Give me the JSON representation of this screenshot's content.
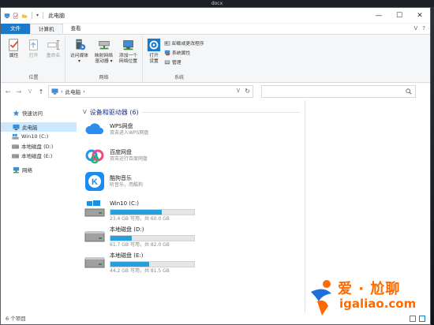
{
  "desktop": {
    "top_text": "docx"
  },
  "window": {
    "title": "此电脑",
    "controls": {
      "minimize": "—",
      "maximize": "☐",
      "close": "✕"
    }
  },
  "ribbon": {
    "tabs": [
      {
        "label": "文件"
      },
      {
        "label": "计算机"
      },
      {
        "label": "查看"
      }
    ],
    "right_controls": {
      "collapse": "ᐯ",
      "help": "?"
    },
    "groups": {
      "location": {
        "label": "位置",
        "buttons": [
          {
            "label": "属性"
          },
          {
            "label": "打开"
          },
          {
            "label": "重命名"
          }
        ]
      },
      "network": {
        "label": "网络",
        "buttons": [
          {
            "label_1": "访问媒体",
            "label_2": "▾"
          },
          {
            "label_1": "映射网络",
            "label_2": "驱动器 ▾"
          },
          {
            "label_1": "添加一个",
            "label_2": "网络位置"
          }
        ]
      },
      "system": {
        "label": "系统",
        "open_settings": {
          "label_1": "打开",
          "label_2": "设置"
        },
        "items": [
          {
            "label": "卸载或更改程序"
          },
          {
            "label": "系统属性"
          },
          {
            "label": "管理"
          }
        ]
      }
    }
  },
  "address": {
    "back": "←",
    "forward": "→",
    "recent": "ᐯ",
    "up": "↑",
    "separator": "›",
    "location": "此电脑",
    "location_sep": "›",
    "dropdown": "ᐯ",
    "refresh": "↻",
    "search_placeholder": ""
  },
  "nav": {
    "quick_access": "快速访问",
    "this_pc": "此电脑",
    "drives": [
      {
        "label": "Win10 (C:)"
      },
      {
        "label": "本地磁盘 (D:)"
      },
      {
        "label": "本地磁盘 (E:)"
      }
    ],
    "network": "网络"
  },
  "content": {
    "group_title": "设备和驱动器 (6)",
    "apps": [
      {
        "name": "WPS网盘",
        "subtitle": "双击进入WPS网盘"
      },
      {
        "name": "百度网盘",
        "subtitle": "双击运行百度网盘"
      },
      {
        "name": "酷狗音乐",
        "subtitle": "听音乐，用酷狗"
      }
    ],
    "drives": [
      {
        "name": "Win10 (C:)",
        "free_text": "23.4 GB 可用，共 60.0 GB",
        "used_fraction": 0.61,
        "windows": true
      },
      {
        "name": "本地磁盘 (D:)",
        "free_text": "61.7 GB 可用，共 82.0 GB",
        "used_fraction": 0.25,
        "windows": false
      },
      {
        "name": "本地磁盘 (E:)",
        "free_text": "44.2 GB 可用，共 81.5 GB",
        "used_fraction": 0.46,
        "windows": false
      }
    ]
  },
  "status": {
    "items_count": "6 个项目"
  },
  "watermark": {
    "line1": "爱 · 尬聊",
    "line2": "igaliao.com"
  },
  "colors": {
    "accent": "#1979ca",
    "drive_bar": "#26a0da",
    "group_title": "#1e3287",
    "watermark": "#ff6a00"
  }
}
